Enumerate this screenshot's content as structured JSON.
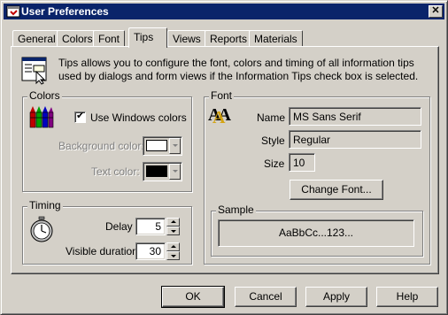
{
  "window": {
    "title": "User Preferences",
    "close_glyph": "✕",
    "icon": "app-icon"
  },
  "tabs": [
    {
      "label": "General",
      "active": false
    },
    {
      "label": "Colors",
      "active": false
    },
    {
      "label": "Font",
      "active": false
    },
    {
      "label": "Tips",
      "active": true
    },
    {
      "label": "Views",
      "active": false
    },
    {
      "label": "Reports",
      "active": false
    },
    {
      "label": "Materials",
      "active": false
    }
  ],
  "intro": {
    "text": "Tips allows you to configure the font, colors and timing of all information tips used by dialogs and form views if the Information Tips check box is selected.",
    "icon": "tooltip-window-icon"
  },
  "colors_group": {
    "title": "Colors",
    "icon": "crayons-icon",
    "use_windows_colors_label": "Use Windows colors",
    "use_windows_colors_checked": true,
    "check_glyph": "✔",
    "background_color_label": "Background color:",
    "background_color_value": "#ffffff",
    "text_color_label": "Text color:",
    "text_color_value": "#000000"
  },
  "timing_group": {
    "title": "Timing",
    "icon": "stopwatch-icon",
    "delay_label": "Delay",
    "delay_value": "5",
    "visible_duration_label": "Visible duration",
    "visible_duration_value": "30"
  },
  "font_group": {
    "title": "Font",
    "icon": "font-aa-icon",
    "icon_text": "AA",
    "name_label": "Name",
    "name_value": "MS Sans Serif",
    "style_label": "Style",
    "style_value": "Regular",
    "size_label": "Size",
    "size_value": "10",
    "change_font_label": "Change Font..."
  },
  "sample_group": {
    "title": "Sample",
    "text": "AaBbCc...123..."
  },
  "buttons": {
    "ok": "OK",
    "cancel": "Cancel",
    "apply": "Apply",
    "help": "Help"
  },
  "colors": {
    "titlebar": "#0a246a",
    "face": "#d4d0c8"
  }
}
